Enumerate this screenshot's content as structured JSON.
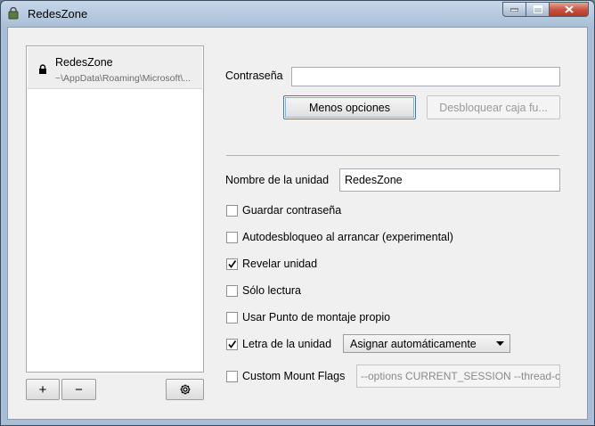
{
  "window": {
    "title": "RedesZone"
  },
  "vaults": [
    {
      "name": "RedesZone",
      "path": "~\\AppData\\Roaming\\Microsoft\\...",
      "icon": "lock-icon"
    }
  ],
  "vault_actions": {
    "add": "+",
    "remove": "−"
  },
  "unlock": {
    "password_label": "Contraseña",
    "password_value": "",
    "less_options_button": "Menos opciones",
    "unlock_button": "Desbloquear caja fu..."
  },
  "options": {
    "drive_name_label": "Nombre de la unidad",
    "drive_name_value": "RedesZone",
    "save_password": {
      "label": "Guardar contraseña",
      "checked": false
    },
    "auto_unlock": {
      "label": "Autodesbloqueo al arrancar (experimental)",
      "checked": false
    },
    "reveal_drive": {
      "label": "Revelar unidad",
      "checked": true
    },
    "read_only": {
      "label": "Sólo lectura",
      "checked": false
    },
    "custom_mount_point": {
      "label": "Usar Punto de montaje propio",
      "checked": false
    },
    "drive_letter": {
      "label": "Letra de la unidad",
      "checked": true,
      "selected": "Asignar automáticamente"
    },
    "custom_mount_flags": {
      "label": "Custom Mount Flags",
      "checked": false,
      "value": "--options CURRENT_SESSION --thread-c"
    }
  },
  "colors": {
    "close_button": "#c6513c",
    "focus_border": "#3c7fb1"
  }
}
